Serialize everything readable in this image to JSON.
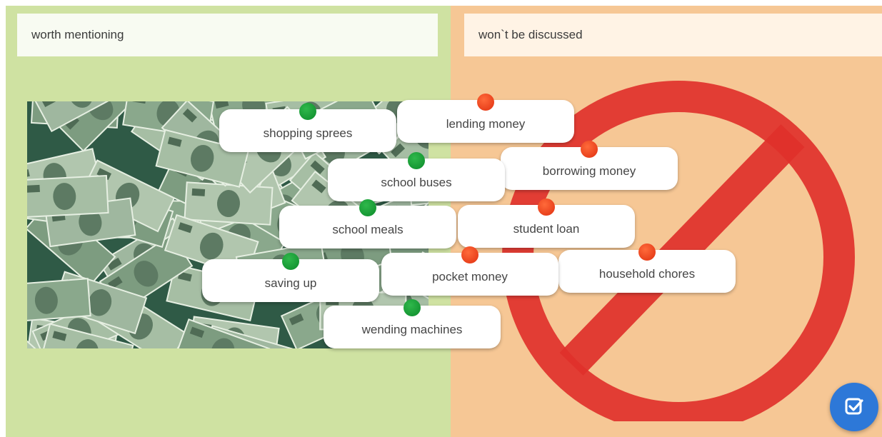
{
  "columns": {
    "left": {
      "title": "worth mentioning",
      "color": "#cfe2a2"
    },
    "right": {
      "title": "won`t be discussed",
      "color": "#f6c795"
    }
  },
  "cards": [
    {
      "label": "shopping sprees",
      "dot": "green"
    },
    {
      "label": "lending money",
      "dot": "red"
    },
    {
      "label": "borrowing money",
      "dot": "red"
    },
    {
      "label": "school buses",
      "dot": "green"
    },
    {
      "label": "school meals",
      "dot": "green"
    },
    {
      "label": "student loan",
      "dot": "red"
    },
    {
      "label": "household chores",
      "dot": "red"
    },
    {
      "label": "saving up",
      "dot": "green"
    },
    {
      "label": "pocket money",
      "dot": "red"
    },
    {
      "label": "wending machines",
      "dot": "green"
    }
  ],
  "check_button": {
    "icon": "check-square-icon",
    "color": "#2d78d8"
  },
  "images": {
    "left": "money-banknotes-image",
    "right": "prohibition-sign-icon"
  }
}
